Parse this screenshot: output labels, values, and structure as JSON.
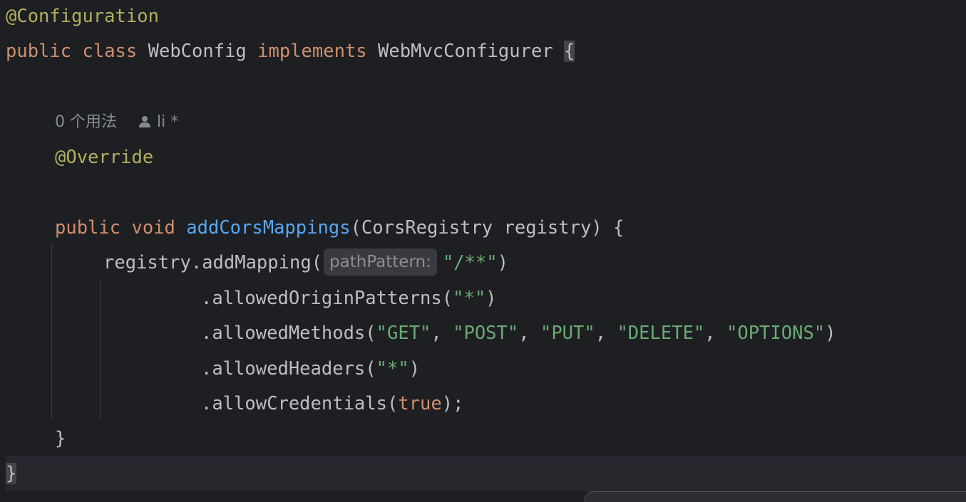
{
  "editor": {
    "lines": {
      "l1": {
        "annotation": "@Configuration"
      },
      "l2": {
        "kw_public": "public",
        "kw_class": "class",
        "class_name": "WebConfig",
        "kw_implements": "implements",
        "interface_name": "WebMvcConfigurer",
        "open_brace": "{"
      },
      "usage_hint": {
        "usages": "0 个用法",
        "author": "li *"
      },
      "l4": {
        "annotation": "@Override"
      },
      "l5": {
        "kw_public": "public",
        "kw_void": "void",
        "method_name": "addCorsMappings",
        "params": "(CorsRegistry registry) {"
      },
      "l6": {
        "call": "registry.addMapping(",
        "inlay_hint": "pathPattern:",
        "arg": "\"/**\"",
        "close": ")"
      },
      "l7": {
        "call": ".allowedOriginPatterns(",
        "arg": "\"*\"",
        "close": ")"
      },
      "l8": {
        "call": ".allowedMethods(",
        "a1": "\"GET\"",
        "a2": "\"POST\"",
        "a3": "\"PUT\"",
        "a4": "\"DELETE\"",
        "a5": "\"OPTIONS\"",
        "sep": ", ",
        "close": ")"
      },
      "l9": {
        "call": ".allowedHeaders(",
        "arg": "\"*\"",
        "close": ")"
      },
      "l10": {
        "call": ".allowCredentials(",
        "kw_true": "true",
        "close": ");"
      },
      "l11": {
        "close_brace": "}"
      },
      "l12": {
        "close_brace": "}"
      }
    },
    "colors": {
      "background": "#1e1f22",
      "keyword": "#cf8e6d",
      "annotation": "#b3ae60",
      "function": "#56a8f5",
      "string": "#6aab73",
      "text": "#bcbec4"
    },
    "icons": {
      "author_icon": "person-icon"
    }
  }
}
